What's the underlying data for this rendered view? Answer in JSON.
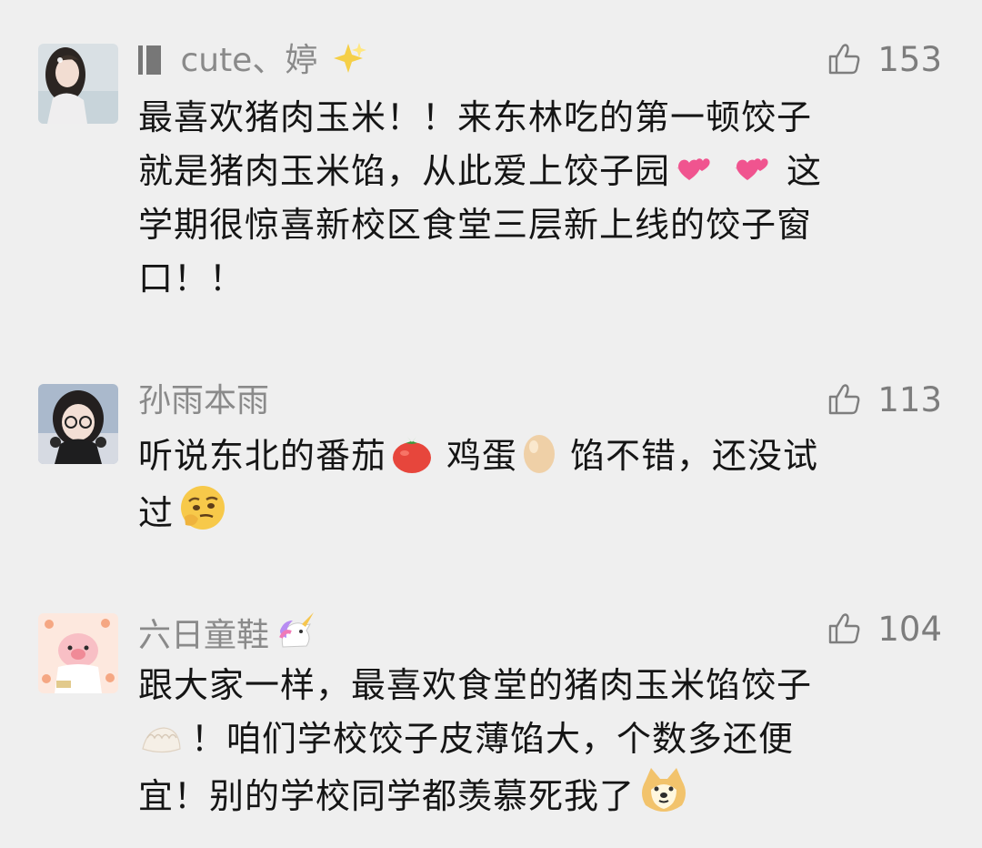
{
  "comments": [
    {
      "username": "cute、婷",
      "likes": "153",
      "emoji": {
        "username_suffix": "sparkles-icon"
      },
      "text_lines": [
        "最喜欢猪肉玉米！！来东林吃的第一顿饺子",
        "就是猪肉玉米馅，从此爱上饺子园",
        "这",
        "学期很惊喜新校区食堂三层新上线的饺子窗",
        "口！！"
      ]
    },
    {
      "username": "孙雨本雨",
      "likes": "113",
      "text_parts": [
        "听说东北的番茄",
        "鸡蛋",
        "馅不错，还没试",
        "过"
      ]
    },
    {
      "username": "六日童鞋",
      "likes": "104",
      "emoji": {
        "username_suffix": "unicorn-icon"
      },
      "text_parts": [
        "跟大家一样，最喜欢食堂的猪肉玉米馅饺子",
        "！咱们学校饺子皮薄馅大，个数多还便",
        "宜！别的学校同学都羡慕死我了"
      ]
    }
  ],
  "colors": {
    "background": "#efefef",
    "username": "#8a8a8a",
    "text": "#151515",
    "likes": "#7d7d7d",
    "heart": "#f0548f"
  }
}
